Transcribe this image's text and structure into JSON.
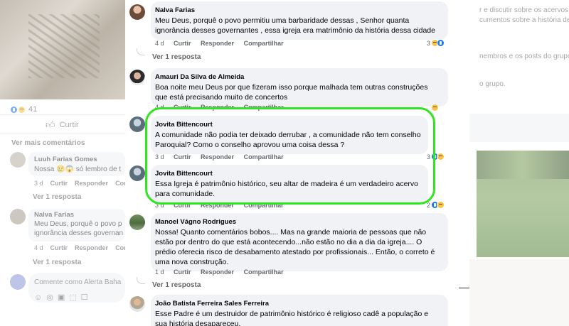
{
  "background": {
    "left": {
      "reactions_count": "41",
      "like_label": "Curtir",
      "more_comments": "Ver mais comentários",
      "comment1": {
        "author": "Luuh Farias Gomes",
        "text": "Nossa 😢😱 só lembro de t",
        "time": "3 d",
        "like": "Curtir",
        "reply": "Responder",
        "share": "Com",
        "replies": "Ver 1 resposta"
      },
      "comment2": {
        "author": "Nalva Farias",
        "text_line1": "Meu Deus, porquê o povo p",
        "text_line2": "ignorância desses governan",
        "time": "4 d",
        "like": "Curtir",
        "reply": "Responder",
        "share": "Com",
        "replies": "Ver 1 resposta"
      },
      "comment_placeholder": "Comente como Alerta Baha"
    },
    "right": {
      "line1": "r e discutir sobre os acervos",
      "line2": "cumentos sobre a história de",
      "line3": "nembros e os posts do grupo.",
      "line4": "o grupo."
    }
  },
  "comments": [
    {
      "author": "Nalva Farias",
      "text": "Meu Deus, porquê o povo permitiu uma barbaridade dessas , Senhor quanta ignorância desses governantes , essa igreja era matrimônio da história dessa cidade",
      "time": "4 d",
      "like": "Curtir",
      "reply": "Responder",
      "share": "Compartilhar",
      "reactions": "3",
      "replies": "Ver 1 resposta"
    },
    {
      "author": "Amauri Da Silva de Almeida",
      "text": "Boa noite meu Deus por que fizeram isso porque malhada tem outras construções que está precisando muito de concertos",
      "time": "4 d",
      "like": "Curtir",
      "reply": "Responder",
      "share": "Compartilhar",
      "reactions": ""
    },
    {
      "author": "Jovita Bittencourt",
      "text": "A comunidade não podia ter deixado derrubar , a comunidade não tem conselho Paroquial? Como o conselho aprovou uma coisa dessa ?",
      "time": "3 d",
      "like": "Curtir",
      "reply": "Responder",
      "share": "Compartilhar",
      "reactions": "3"
    },
    {
      "author": "Jovita Bittencourt",
      "text": "Essa Igreja é patrimônio histórico, seu altar de madeira é um verdadeiro acervo para comunidade.",
      "time": "3 d",
      "like": "Curtir",
      "reply": "Responder",
      "share": "Compartilhar",
      "reactions": "2"
    },
    {
      "author": "Manoel Vágno Rodrigues",
      "text": "Nossa! Quanto comentários bobos.... Mas na grande maioria de pessoas que não estão por dentro do que está acontecendo...não estão no dia a dia da igreja.... O prédio oferecia risco de desabamento atestado por profissionais... Então, o correto é uma nova construção.",
      "time": "1 d",
      "like": "Curtir",
      "reply": "Responder",
      "share": "Compartilhar",
      "replies": "Ver 1 resposta"
    },
    {
      "author": "João Batista Ferreira Sales Ferreira",
      "text": "Esse Padre é um destruidor de patrimônio histórico é religioso cadê a população e sua história desapareceu."
    }
  ],
  "colors": {
    "highlight": "#2ee51f",
    "bubble": "#f0f2f5",
    "muted_text": "#65676b"
  }
}
